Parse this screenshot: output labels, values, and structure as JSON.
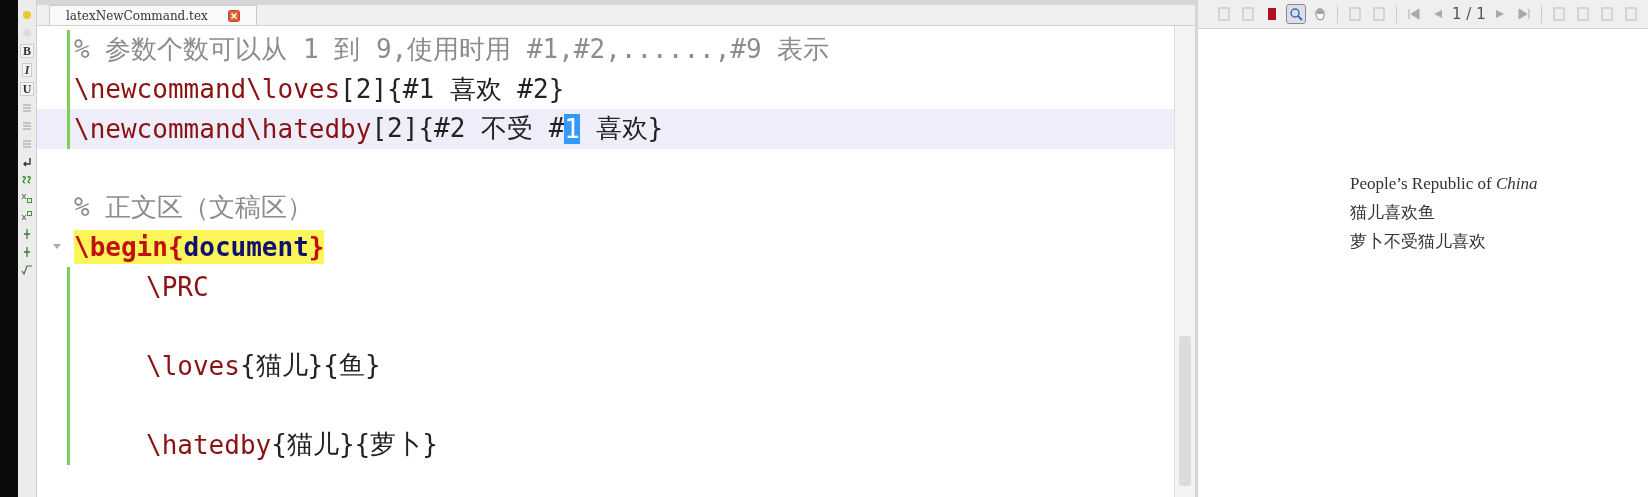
{
  "tab": {
    "label": "latexNewCommand.tex"
  },
  "format_toolbar": [
    {
      "kind": "dot"
    },
    {
      "kind": "blank"
    },
    {
      "kind": "text",
      "label": "B"
    },
    {
      "kind": "text",
      "label": "I"
    },
    {
      "kind": "text",
      "label": "U"
    },
    {
      "kind": "align"
    },
    {
      "kind": "align"
    },
    {
      "kind": "align"
    },
    {
      "kind": "return"
    },
    {
      "kind": "ss"
    },
    {
      "kind": "sub"
    },
    {
      "kind": "sup"
    },
    {
      "kind": "frac"
    },
    {
      "kind": "frac"
    },
    {
      "kind": "sqrt"
    }
  ],
  "editor": {
    "lines": [
      {
        "current": false,
        "matched": false,
        "changed": true,
        "fold": false,
        "indented": false,
        "tokens": [
          {
            "kind": "comment",
            "text": "% 参数个数可以从 1 到 9,使用时用 #1,#2,......,#9 表示"
          }
        ]
      },
      {
        "current": false,
        "matched": false,
        "changed": true,
        "fold": false,
        "indented": false,
        "tokens": [
          {
            "kind": "cmd",
            "text": "\\newcommand\\loves"
          },
          {
            "kind": "plain",
            "text": "[2]{#1 喜欢 #2}"
          }
        ]
      },
      {
        "current": true,
        "matched": false,
        "changed": true,
        "fold": false,
        "indented": false,
        "tokens": [
          {
            "kind": "cmd",
            "text": "\\newcommand\\hatedby"
          },
          {
            "kind": "plain",
            "text": "[2]{#2 不受 #"
          },
          {
            "kind": "selection",
            "text": "1"
          },
          {
            "kind": "plain",
            "text": " 喜欢}"
          }
        ]
      },
      {
        "current": false,
        "matched": false,
        "changed": false,
        "fold": false
      },
      {
        "current": false,
        "matched": false,
        "changed": false,
        "fold": false,
        "indented": false,
        "tokens": [
          {
            "kind": "comment",
            "text": "% 正文区（文稿区）"
          }
        ]
      },
      {
        "current": false,
        "matched": true,
        "changed": false,
        "fold": true,
        "indented": false,
        "tokens": [
          {
            "kind": "begin",
            "text": "\\begin{"
          },
          {
            "kind": "env",
            "text": "document"
          },
          {
            "kind": "begin",
            "text": "}"
          }
        ]
      },
      {
        "current": false,
        "matched": false,
        "changed": true,
        "fold": false,
        "indented": true,
        "tokens": [
          {
            "kind": "cmd",
            "text": "\\PRC"
          }
        ]
      },
      {
        "current": false,
        "matched": false,
        "changed": true,
        "fold": false
      },
      {
        "current": false,
        "matched": false,
        "changed": true,
        "fold": false,
        "indented": true,
        "tokens": [
          {
            "kind": "cmd",
            "text": "\\loves"
          },
          {
            "kind": "plain",
            "text": "{猫儿}{鱼}"
          }
        ]
      },
      {
        "current": false,
        "matched": false,
        "changed": true,
        "fold": false
      },
      {
        "current": false,
        "matched": false,
        "changed": true,
        "fold": false,
        "indented": true,
        "tokens": [
          {
            "kind": "cmd",
            "text": "\\hatedby"
          },
          {
            "kind": "plain",
            "text": "{猫儿}{萝卜}"
          }
        ]
      }
    ]
  },
  "preview": {
    "toolbar": [
      {
        "kind": "icon"
      },
      {
        "kind": "icon"
      },
      {
        "kind": "book"
      },
      {
        "kind": "zoom",
        "selected": true
      },
      {
        "kind": "hand"
      },
      {
        "kind": "sep"
      },
      {
        "kind": "icon"
      },
      {
        "kind": "icon"
      },
      {
        "kind": "sep"
      },
      {
        "kind": "first"
      },
      {
        "kind": "prev"
      },
      {
        "kind": "page",
        "label": "1 / 1"
      },
      {
        "kind": "next"
      },
      {
        "kind": "last"
      },
      {
        "kind": "sep"
      },
      {
        "kind": "icon"
      },
      {
        "kind": "icon"
      },
      {
        "kind": "icon"
      },
      {
        "kind": "icon"
      }
    ],
    "lines": [
      "People’s Republic of *China*",
      "猫儿喜欢鱼",
      "萝卜不受猫儿喜欢"
    ]
  }
}
